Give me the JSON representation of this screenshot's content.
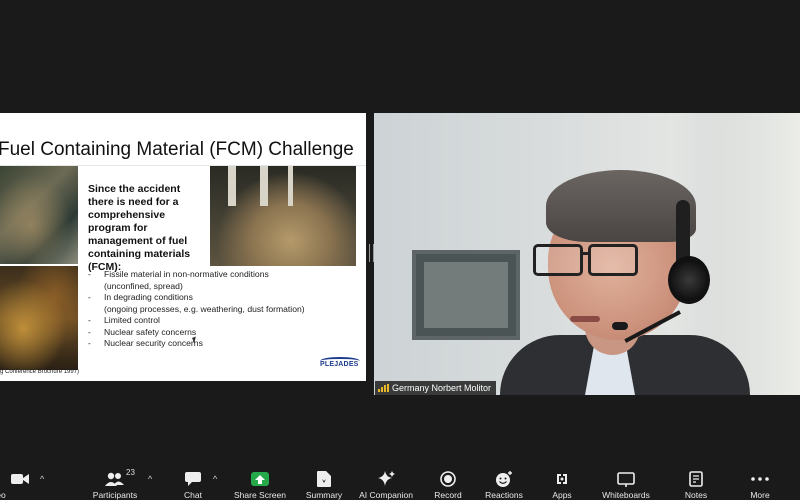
{
  "slide": {
    "title": "Fuel Containing Material (FCM) Challenge",
    "bold_text": "Since the accident there is need for a comprehensive program for management of fuel containing materials (FCM):",
    "bullets": [
      {
        "dash": "-",
        "line1": "Fissile material in non-normative conditions",
        "line2": "(unconfined, spread)"
      },
      {
        "dash": "-",
        "line1": "In degrading conditions",
        "line2": "(ongoing processes, e.g. weathering, dust formation)"
      },
      {
        "dash": "-",
        "line1": "Limited control",
        "line2": ""
      },
      {
        "dash": "-",
        "line1": "Nuclear safety concerns",
        "line2": ""
      },
      {
        "dash": "-",
        "line1": "Nuclear security concerns",
        "line2": ""
      }
    ],
    "caption": "g Conference Brochure 1997)",
    "logo": "PLEJADES"
  },
  "video": {
    "participant_name": "Germany Norbert Molitor"
  },
  "toolbar": {
    "items": [
      {
        "label": "top Video",
        "icon": "video-camera-icon"
      },
      {
        "label": "Participants",
        "icon": "participants-icon",
        "count": "23"
      },
      {
        "label": "Chat",
        "icon": "chat-icon"
      },
      {
        "label": "Share Screen",
        "icon": "share-screen-icon"
      },
      {
        "label": "Summary",
        "icon": "summary-icon"
      },
      {
        "label": "AI Companion",
        "icon": "ai-companion-icon"
      },
      {
        "label": "Record",
        "icon": "record-icon"
      },
      {
        "label": "Reactions",
        "icon": "reactions-icon"
      },
      {
        "label": "Apps",
        "icon": "apps-icon"
      },
      {
        "label": "Whiteboards",
        "icon": "whiteboards-icon"
      },
      {
        "label": "Notes",
        "icon": "notes-icon"
      },
      {
        "label": "More",
        "icon": "more-icon"
      }
    ],
    "caret": "^",
    "colors": {
      "share": "#25a94a",
      "background": "#1a1a1a"
    }
  }
}
